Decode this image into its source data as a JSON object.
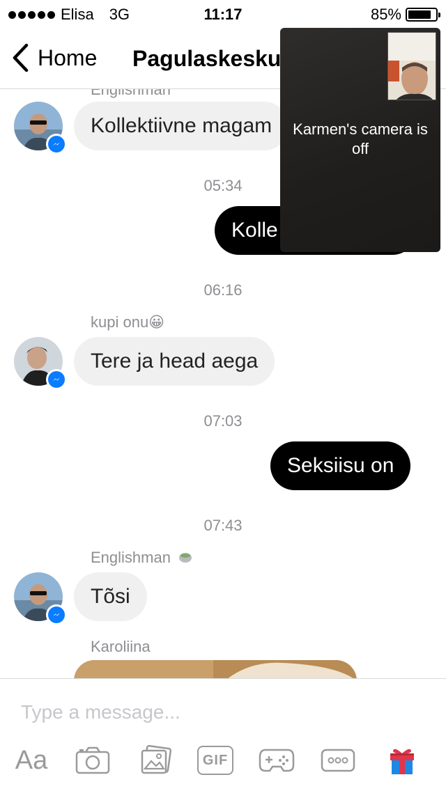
{
  "status_bar": {
    "carrier": "Elisa",
    "network": "3G",
    "time": "11:17",
    "battery_percent": "85%",
    "battery_level": 0.85
  },
  "nav": {
    "back_label": "Home",
    "title": "Pagulaskesku"
  },
  "video_call": {
    "camera_off_text": "Karmen's camera is off"
  },
  "messages": {
    "top_partial_sender": "Englishman",
    "msg1": "Kollektiivne magam",
    "ts1": "05:34",
    "out1": "Kolle",
    "ts2": "06:16",
    "sender2": "kupi onu😀",
    "msg2": "Tere ja head aega",
    "ts3": "07:03",
    "out2": "Seksiisu on",
    "ts4": "07:43",
    "sender3": "Englishman",
    "msg3": "Tõsi",
    "sender4": "Karoliina"
  },
  "composer": {
    "placeholder": "Type a message...",
    "aa_label": "Aa",
    "gif_label": "GIF"
  },
  "colors": {
    "messenger_blue": "#0a7cff",
    "incoming_bubble": "#f1f0f0",
    "outgoing_bubble": "#000000",
    "meta_text": "#8e8e93",
    "gift_red": "#e0364a",
    "gift_blue": "#1e88e5"
  },
  "icons": [
    "chevron-left-icon",
    "camera-icon",
    "gallery-icon",
    "gif-icon",
    "game-controller-icon",
    "more-icon",
    "gift-icon",
    "messenger-badge-icon"
  ]
}
